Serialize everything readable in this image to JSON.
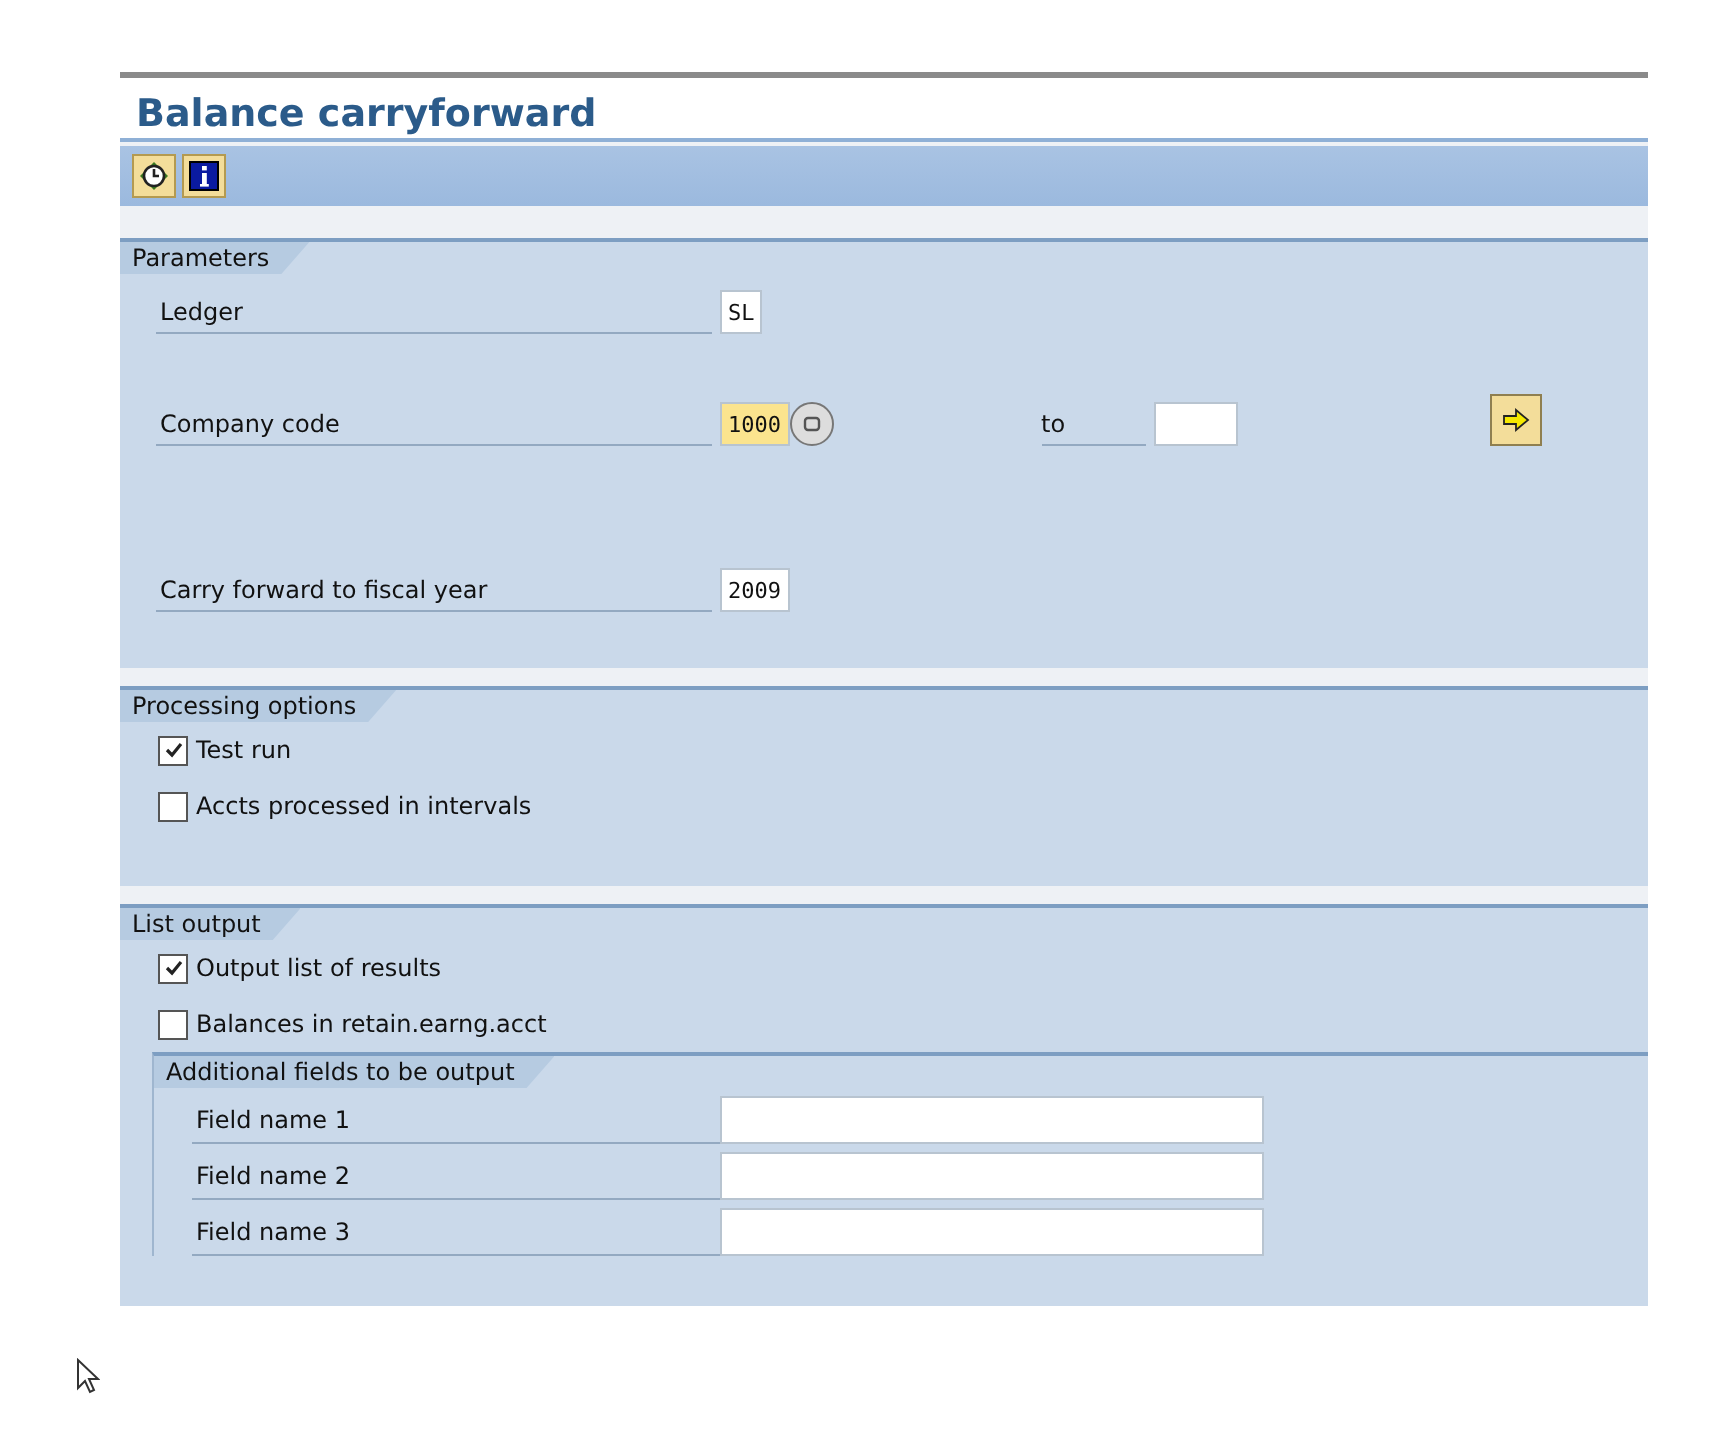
{
  "title": "Balance carryforward",
  "toolbar": [
    {
      "kind": "execute"
    },
    {
      "kind": "info"
    }
  ],
  "parameters": {
    "title": "Parameters",
    "rows": [
      {
        "label": "Ledger",
        "value": "SL",
        "focused": false
      },
      {
        "label": "Company code",
        "value": "1000",
        "focused": true,
        "search_help": true,
        "to_label": "to",
        "multiple_selection": true
      },
      {
        "label": "Carry forward to fiscal year",
        "value": "2009",
        "focused": false
      }
    ]
  },
  "processing_options": {
    "title": "Processing options",
    "options": [
      {
        "label": "Test run",
        "checked": true
      },
      {
        "label": "Accts processed in intervals",
        "checked": false
      }
    ]
  },
  "list_output": {
    "title": "List output",
    "options": [
      {
        "label": "Output list of results",
        "checked": true
      },
      {
        "label": "Balances in retain.earng.acct",
        "checked": false
      }
    ],
    "additional_fields": {
      "title": "Additional fields to be output",
      "fields": [
        {
          "label": "Field name 1"
        },
        {
          "label": "Field name 2"
        },
        {
          "label": "Field name 3"
        }
      ]
    }
  }
}
